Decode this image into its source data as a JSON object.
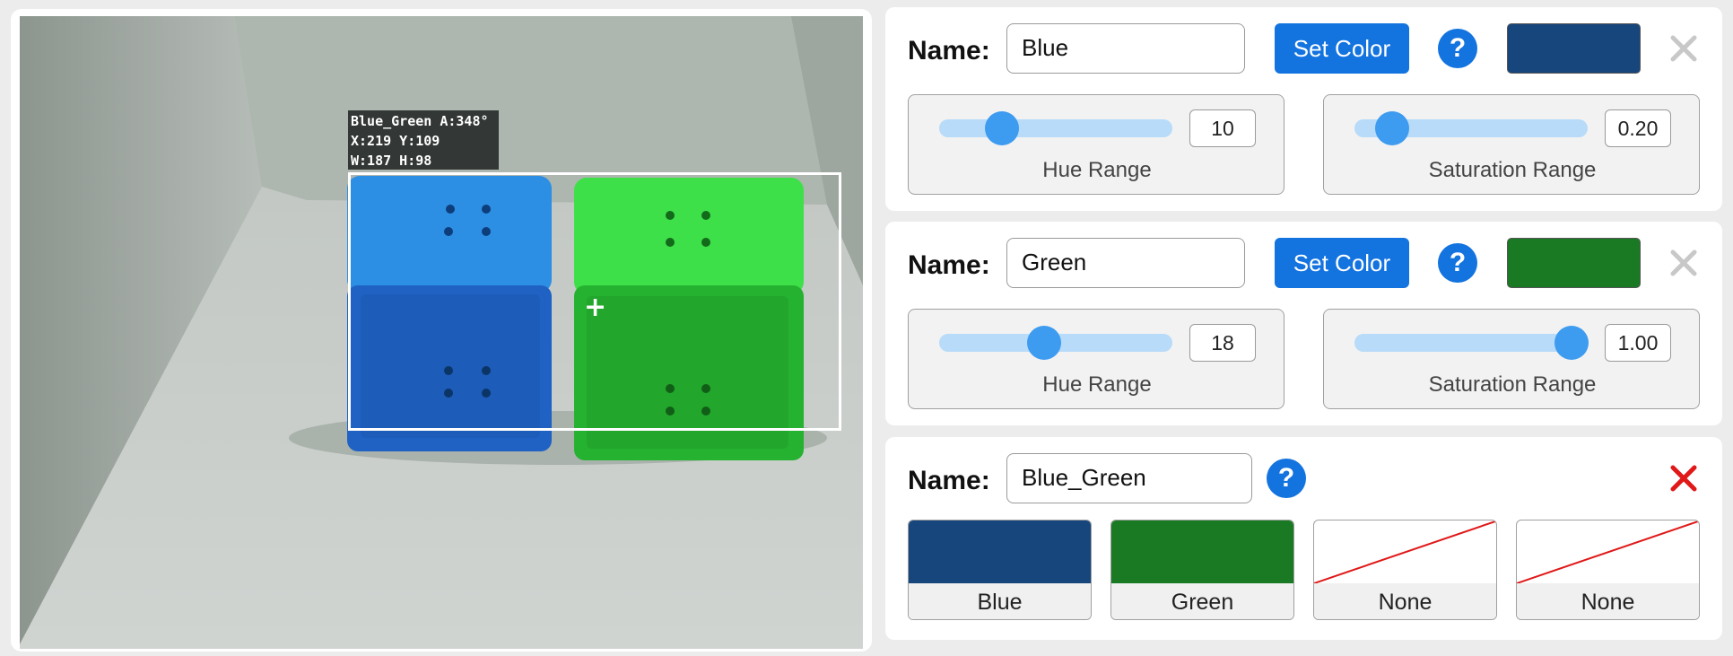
{
  "camera": {
    "overlay_lines": [
      "Blue_Green A:348°",
      "X:219 Y:109",
      "W:187 H:98"
    ]
  },
  "colors": {
    "blue_swatch": "#16467c",
    "green_swatch": "#1a7a24",
    "accent": "#1373df",
    "close_active": "#e01818",
    "close_disabled": "#c8c8c8"
  },
  "cards": [
    {
      "name_label": "Name:",
      "name_value": "Blue",
      "set_color_label": "Set Color",
      "help_label": "?",
      "hue_value": "10",
      "hue_fraction": 0.27,
      "hue_caption": "Hue Range",
      "sat_value": "0.20",
      "sat_fraction": 0.16,
      "sat_caption": "Saturation Range"
    },
    {
      "name_label": "Name:",
      "name_value": "Green",
      "set_color_label": "Set Color",
      "help_label": "?",
      "hue_value": "18",
      "hue_fraction": 0.45,
      "hue_caption": "Hue Range",
      "sat_value": "1.00",
      "sat_fraction": 0.93,
      "sat_caption": "Saturation Range"
    }
  ],
  "combo": {
    "name_label": "Name:",
    "name_value": "Blue_Green",
    "help_label": "?",
    "tiles": [
      {
        "label": "Blue",
        "color": "#16467c"
      },
      {
        "label": "Green",
        "color": "#1a7a24"
      },
      {
        "label": "None",
        "color": ""
      },
      {
        "label": "None",
        "color": ""
      }
    ]
  }
}
